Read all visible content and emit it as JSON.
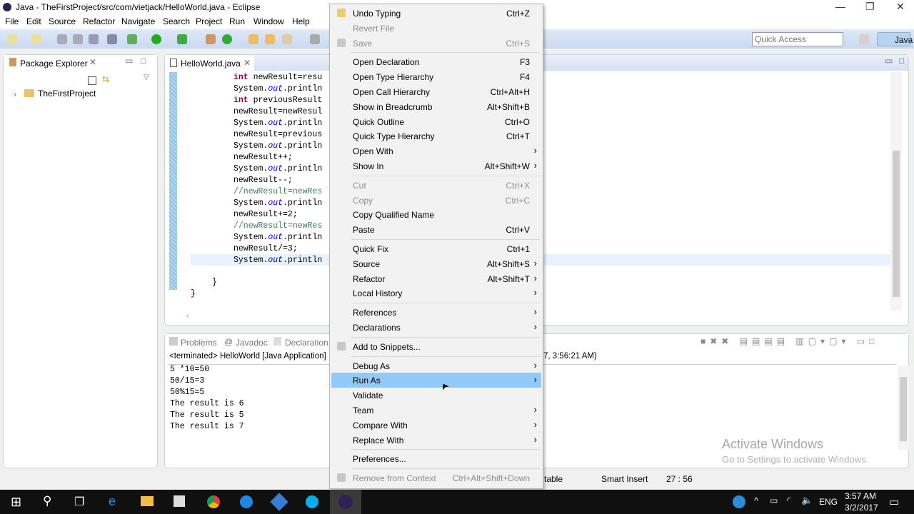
{
  "window": {
    "title": "Java - TheFirstProject/src/com/vietjack/HelloWorld.java - Eclipse",
    "minimize": "—",
    "restore": "❐",
    "close": "✕"
  },
  "menubar": [
    "File",
    "Edit",
    "Source",
    "Refactor",
    "Navigate",
    "Search",
    "Project",
    "Run",
    "Window",
    "Help"
  ],
  "quick_access": {
    "placeholder": "Quick Access"
  },
  "perspective": "Java",
  "package_explorer": {
    "title": "Package Explorer",
    "project": "TheFirstProject"
  },
  "editor": {
    "tab": "HelloWorld.java",
    "lines": [
      [
        [
          "kw",
          "int"
        ],
        [
          "t",
          " newResult=resu"
        ]
      ],
      [
        [
          "t",
          "System."
        ],
        [
          "fld",
          "out"
        ],
        [
          "t",
          ".println"
        ]
      ],
      [
        [
          "kw",
          "int"
        ],
        [
          "t",
          " previousResult"
        ]
      ],
      [
        [
          "t",
          "newResult=newResul"
        ]
      ],
      [
        [
          "t",
          "System."
        ],
        [
          "fld",
          "out"
        ],
        [
          "t",
          ".println"
        ]
      ],
      [
        [
          "t",
          "newResult=previous"
        ]
      ],
      [
        [
          "t",
          "System."
        ],
        [
          "fld",
          "out"
        ],
        [
          "t",
          ".println"
        ]
      ],
      [
        [
          "t",
          "newResult++;"
        ]
      ],
      [
        [
          "t",
          "System."
        ],
        [
          "fld",
          "out"
        ],
        [
          "t",
          ".println"
        ]
      ],
      [
        [
          "t",
          "newResult--;"
        ]
      ],
      [
        [
          "cm",
          "//newResult=newRes"
        ]
      ],
      [
        [
          "t",
          "System."
        ],
        [
          "fld",
          "out"
        ],
        [
          "t",
          ".println"
        ]
      ],
      [
        [
          "t",
          "newResult+=2;"
        ]
      ],
      [
        [
          "cm",
          "//newResult=newRes"
        ]
      ],
      [
        [
          "t",
          "System."
        ],
        [
          "fld",
          "out"
        ],
        [
          "t",
          ".println"
        ]
      ],
      [
        [
          "t",
          "newResult/=3;"
        ]
      ],
      [
        [
          "t",
          "System."
        ],
        [
          "fld",
          "out"
        ],
        [
          "t",
          ".println"
        ]
      ]
    ],
    "close_brace_1": "}",
    "close_brace_2": "}"
  },
  "bottom": {
    "tabs": [
      "Problems",
      "Javadoc",
      "Declaration"
    ],
    "console_header": "<terminated> HelloWorld [Java Application]",
    "console_header_tail": "7, 3:56:21 AM)",
    "output": [
      "5 *10=50",
      "50/15=3",
      "50%15=5",
      "The result is 6",
      "The result is 5",
      "The result is 7"
    ]
  },
  "watermark": {
    "line1": "Activate Windows",
    "line2": "Go to Settings to activate Windows."
  },
  "status": {
    "mode": "table",
    "insert": "Smart Insert",
    "position": "27 : 56"
  },
  "context_menu": [
    {
      "label": "Undo Typing",
      "shortcut": "Ctrl+Z",
      "icon": "undo-icon"
    },
    {
      "label": "Revert File",
      "disabled": true
    },
    {
      "label": "Save",
      "shortcut": "Ctrl+S",
      "disabled": true,
      "icon": "save-icon"
    },
    {
      "sep": true
    },
    {
      "label": "Open Declaration",
      "shortcut": "F3"
    },
    {
      "label": "Open Type Hierarchy",
      "shortcut": "F4"
    },
    {
      "label": "Open Call Hierarchy",
      "shortcut": "Ctrl+Alt+H"
    },
    {
      "label": "Show in Breadcrumb",
      "shortcut": "Alt+Shift+B"
    },
    {
      "label": "Quick Outline",
      "shortcut": "Ctrl+O"
    },
    {
      "label": "Quick Type Hierarchy",
      "shortcut": "Ctrl+T"
    },
    {
      "label": "Open With",
      "sub": true
    },
    {
      "label": "Show In",
      "shortcut": "Alt+Shift+W",
      "sub": true
    },
    {
      "sep": true
    },
    {
      "label": "Cut",
      "shortcut": "Ctrl+X",
      "disabled": true
    },
    {
      "label": "Copy",
      "shortcut": "Ctrl+C",
      "disabled": true
    },
    {
      "label": "Copy Qualified Name"
    },
    {
      "label": "Paste",
      "shortcut": "Ctrl+V"
    },
    {
      "sep": true
    },
    {
      "label": "Quick Fix",
      "shortcut": "Ctrl+1"
    },
    {
      "label": "Source",
      "shortcut": "Alt+Shift+S",
      "sub": true
    },
    {
      "label": "Refactor",
      "shortcut": "Alt+Shift+T",
      "sub": true
    },
    {
      "label": "Local History",
      "sub": true
    },
    {
      "sep": true
    },
    {
      "label": "References",
      "sub": true
    },
    {
      "label": "Declarations",
      "sub": true
    },
    {
      "sep": true
    },
    {
      "label": "Add to Snippets...",
      "icon": "snippet-icon"
    },
    {
      "sep": true
    },
    {
      "label": "Debug As",
      "sub": true
    },
    {
      "label": "Run As",
      "sub": true,
      "highlighted": true
    },
    {
      "label": "Validate"
    },
    {
      "label": "Team",
      "sub": true
    },
    {
      "label": "Compare With",
      "sub": true
    },
    {
      "label": "Replace With",
      "sub": true
    },
    {
      "sep": true
    },
    {
      "label": "Preferences..."
    },
    {
      "sep": true
    },
    {
      "label": "Remove from Context",
      "shortcut": "Ctrl+Alt+Shift+Down",
      "disabled": true,
      "icon": "remove-context-icon"
    }
  ],
  "taskbar": {
    "time": "3:57 AM",
    "date": "3/2/2017",
    "lang": "ENG"
  },
  "colors": {
    "highlight": "#91c9f7",
    "toolbar": "#c9daf0",
    "taskbar": "#101010"
  }
}
